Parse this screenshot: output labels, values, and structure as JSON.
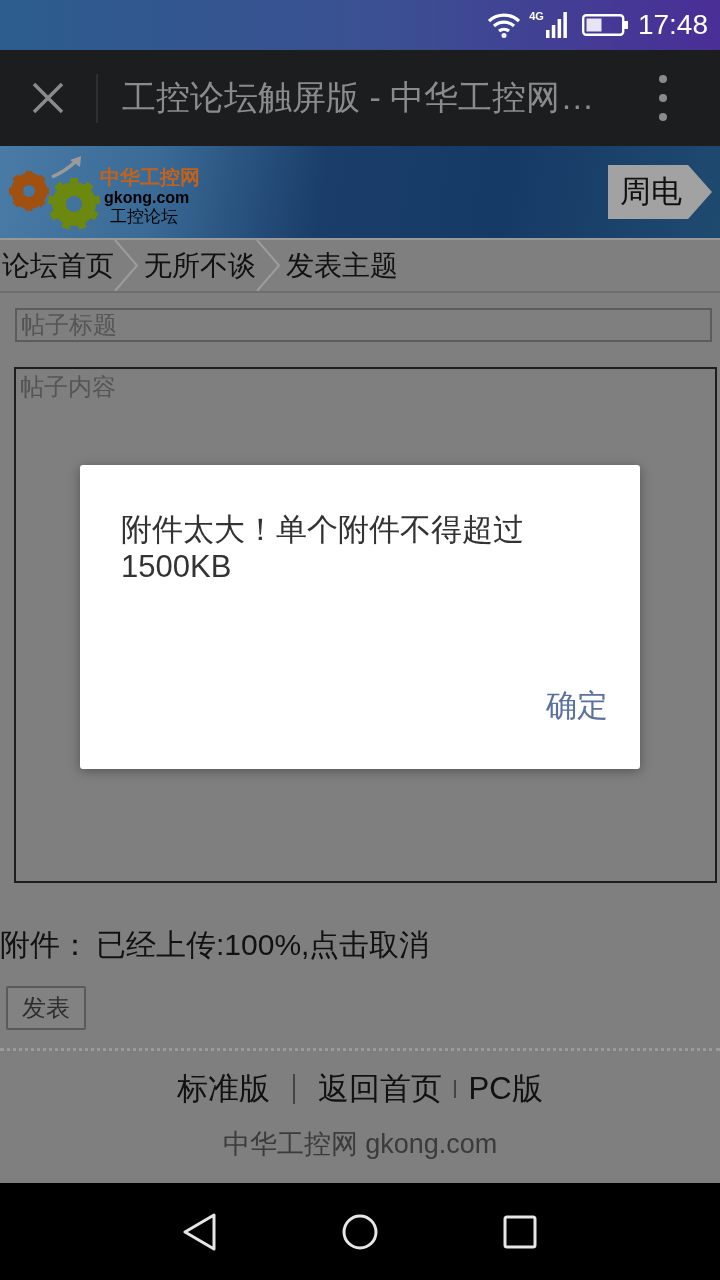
{
  "status_bar": {
    "network": "4G",
    "time": "17:48"
  },
  "browser_bar": {
    "title": "工控论坛触屏版 - 中华工控网…"
  },
  "header": {
    "logo": {
      "name": "中华工控网",
      "domain": "gkong.com",
      "subtitle": "工控论坛"
    },
    "button": "周电"
  },
  "breadcrumb": [
    "论坛首页",
    "无所不谈",
    "发表主题"
  ],
  "form": {
    "title_field": {
      "placeholder": "帖子标题"
    },
    "content_field": {
      "placeholder": "帖子内容"
    },
    "attachment": {
      "label": "附件：",
      "status": "已经上传:100%,点击取消"
    },
    "submit": "发表"
  },
  "footer": {
    "links": [
      "标准版",
      "返回首页",
      "PC版"
    ],
    "copyright": "中华工控网 gkong.com"
  },
  "dialog": {
    "message": "附件太大！单个附件不得超过1500KB",
    "button": "确定"
  }
}
